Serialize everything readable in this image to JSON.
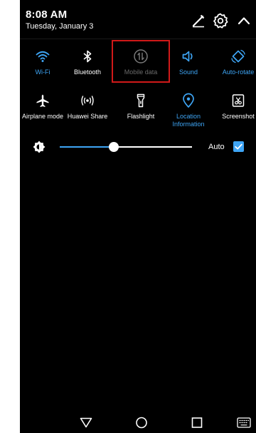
{
  "status": {
    "time": "8:08 AM",
    "date": "Tuesday, January 3"
  },
  "header_icons": [
    "edit-icon",
    "settings-gear-icon",
    "collapse-chevron-up-icon"
  ],
  "tiles": [
    {
      "label": "Wi-Fi",
      "icon": "wifi-icon",
      "state": "active"
    },
    {
      "label": "Bluetooth",
      "icon": "bluetooth-icon",
      "state": "inactive"
    },
    {
      "label": "Mobile data",
      "icon": "mobile-data-icon",
      "state": "disabled",
      "highlighted": true
    },
    {
      "label": "Sound",
      "icon": "sound-icon",
      "state": "active"
    },
    {
      "label": "Auto-rotate",
      "icon": "auto-rotate-icon",
      "state": "active"
    },
    {
      "label": "Airplane mode",
      "icon": "airplane-icon",
      "state": "inactive"
    },
    {
      "label": "Huawei Share",
      "icon": "huawei-share-icon",
      "state": "inactive"
    },
    {
      "label": "Flashlight",
      "icon": "flashlight-icon",
      "state": "inactive"
    },
    {
      "label": "Location Information",
      "icon": "location-icon",
      "state": "active"
    },
    {
      "label": "Screenshot",
      "icon": "screenshot-icon",
      "state": "inactive"
    }
  ],
  "brightness": {
    "icon": "brightness-icon",
    "level": 0.41,
    "auto_label": "Auto",
    "auto_checked": true
  },
  "navbar": {
    "buttons": [
      "back-icon",
      "home-icon",
      "recents-icon",
      "keyboard-icon"
    ]
  },
  "colors": {
    "background": "#000000",
    "accent": "#3ea5f5",
    "highlight_border": "#d11919",
    "disabled_text": "#6b6b6b"
  }
}
